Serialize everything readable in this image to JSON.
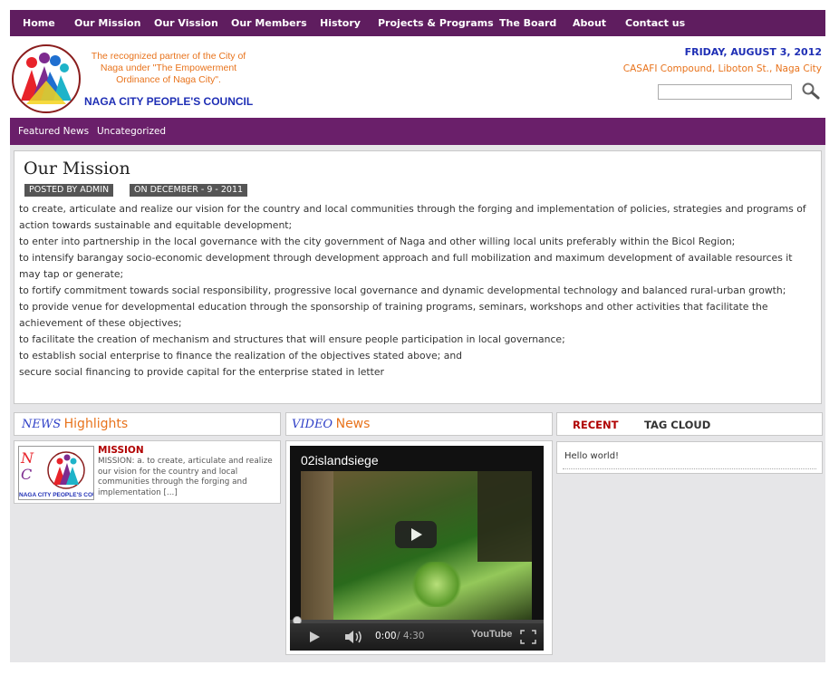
{
  "nav": [
    "Home",
    "Our Mission",
    "Our Vission",
    "Our Members",
    "History",
    "Projects & Programs",
    "The Board",
    "About",
    "Contact us"
  ],
  "header": {
    "tagline": "The recognized partner of the City of Naga under \"The Empowerment Ordinance of Naga City\".",
    "org_name": "NAGA CITY PEOPLE'S COUNCIL",
    "date": "FRIDAY, AUGUST 3, 2012",
    "address": "CASAFI Compound, Liboton St., Naga City",
    "search_placeholder": ""
  },
  "subnav": [
    "Featured News",
    "Uncategorized"
  ],
  "post": {
    "title": "Our Mission",
    "author_tag": "POSTED BY ADMIN",
    "date_tag": "ON DECEMBER - 9 - 2011",
    "paragraphs": [
      "to create, articulate and realize our vision for the country and local communities through the forging and implementation of policies, strategies and programs of action towards sustainable and equitable development;",
      "to enter into partnership in the local governance with the city government of Naga and other willing local units preferably within the Bicol Region;",
      "to intensify barangay socio-economic development through development approach and full mobilization and maximum development of available resources it may tap or generate;",
      "to fortify commitment towards social responsibility, progressive local governance and dynamic developmental technology and balanced rural-urban growth;",
      "to provide venue for developmental education through the sponsorship of training programs, seminars, workshops and other activities that facilitate the achievement of these objectives;",
      "to facilitate the creation of mechanism and structures that will ensure people participation in local governance;",
      "to establish social enterprise to finance the realization of the objectives stated above; and",
      "secure social financing to provide capital for the enterprise stated in letter"
    ]
  },
  "news": {
    "head_script": "NEWS",
    "head_word": "Highlights",
    "thumb_text": "NAGA CITY PEOPLE'S COUNCIL",
    "item_title": "MISSION",
    "item_excerpt": "MISSION: a. to create, articulate and realize our vision for the country and local communities through the forging and implementation [...]"
  },
  "video": {
    "head_script": "VIDEO",
    "head_word": "News",
    "title": "02islandsiege",
    "time_current": "0:00",
    "time_total": "/ 4:30",
    "progress": 0,
    "logo": "YouTube"
  },
  "sidebar": {
    "tab_recent": "RECENT",
    "tab_tags": "TAG CLOUD",
    "recent_item": "Hello world!"
  },
  "colors": {
    "nav_bg": "#5f1d5f",
    "subnav_bg": "#6a1f6a",
    "accent_orange": "#e8731c",
    "accent_blue": "#1f2fb5",
    "news_red": "#b00000"
  }
}
